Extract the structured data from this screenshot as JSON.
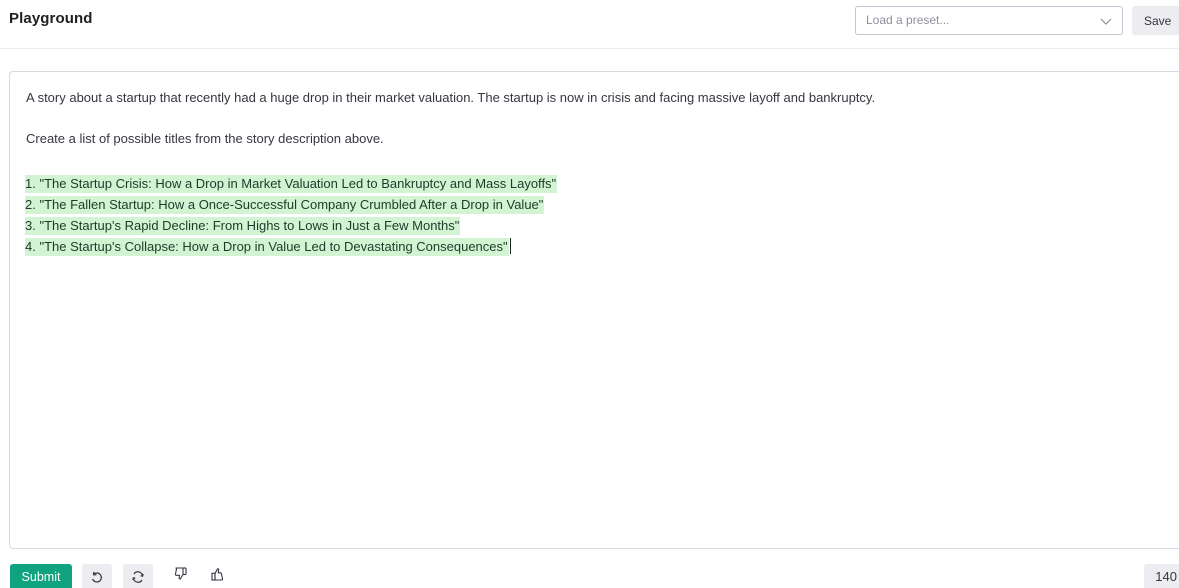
{
  "header": {
    "title": "Playground",
    "preset_placeholder": "Load a preset...",
    "save_label": "Save"
  },
  "editor": {
    "prompt": "A story about a startup that recently had a huge drop in their market valuation. The startup is now in crisis and facing massive layoff and bankruptcy.",
    "instruction": "Create a list of possible titles from the story description above.",
    "completion": [
      "1. \"The Startup Crisis: How a Drop in Market Valuation Led to Bankruptcy and Mass Layoffs\"",
      "2. \"The Fallen Startup: How a Once-Successful Company Crumbled After a Drop in Value\"",
      "3. \"The Startup's Rapid Decline: From Highs to Lows in Just a Few Months\"",
      "4. \"The Startup's Collapse: How a Drop in Value Led to Devastating Consequences\""
    ],
    "completion_highlight_color": "#d2f4d3"
  },
  "footer": {
    "submit_label": "Submit",
    "buttons": [
      "undo-icon",
      "regenerate-icon",
      "thumbs-down-icon",
      "thumbs-up-icon"
    ],
    "token_count": "140"
  },
  "colors": {
    "accent": "#10a37f",
    "button_bg": "#ececf1",
    "border": "#d9d9e3"
  }
}
